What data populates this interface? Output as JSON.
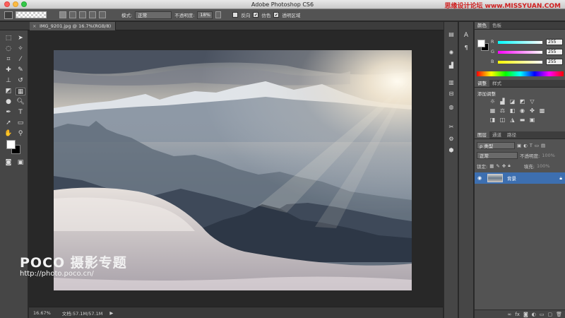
{
  "window": {
    "title": "Adobe Photoshop CS6",
    "watermark_top": "思缘设计论坛 www.MISSYUAN.COM"
  },
  "options_bar": {
    "mode_label": "模式:",
    "mode_value": "正常",
    "opacity_label": "不透明度:",
    "opacity_value": "18%",
    "reverse_label": "反向",
    "dither_label": "仿色",
    "transparency_label": "透明区域"
  },
  "document": {
    "tab_title": "IMG_9201.jpg @ 16.7%(RGB/8)",
    "zoom": "16.67%",
    "doc_info": "文档:57.1M/57.1M"
  },
  "watermark": {
    "brand": "POCO 摄影专题",
    "url": "http://photo.poco.cn/"
  },
  "color_panel": {
    "tabs": [
      "颜色",
      "色板"
    ],
    "r_label": "R",
    "r_value": "255",
    "g_label": "G",
    "g_value": "255",
    "b_label": "B",
    "b_value": "255"
  },
  "adjustments_panel": {
    "tabs": [
      "调整",
      "样式"
    ],
    "title": "添加调整"
  },
  "layers_panel": {
    "tabs": [
      "图层",
      "通道",
      "路径"
    ],
    "filter_value": "ρ 类型",
    "blend_mode": "正常",
    "opacity_label": "不透明度:",
    "opacity_value": "100%",
    "lock_label": "锁定:",
    "fill_label": "填充:",
    "fill_value": "100%",
    "layers": [
      {
        "name": "背景"
      }
    ]
  },
  "colors": {
    "accent": "#3d6fb0",
    "panel": "#535353",
    "canvas_bg": "#282828"
  }
}
